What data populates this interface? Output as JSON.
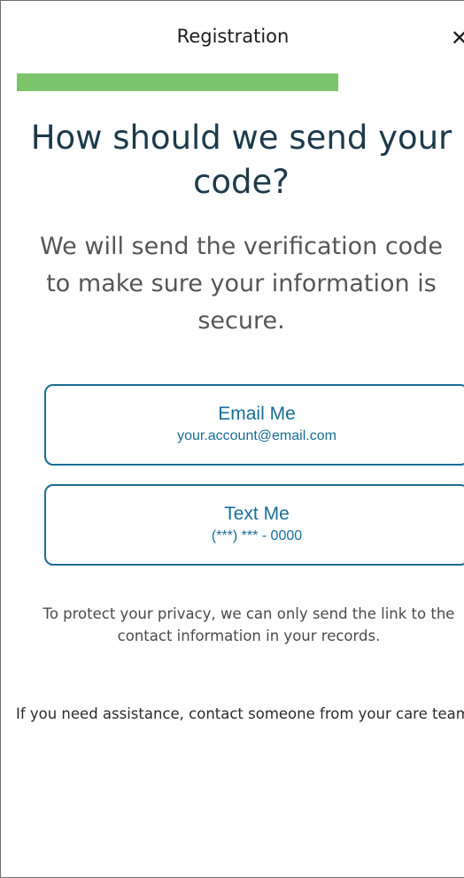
{
  "header": {
    "title": "Registration",
    "close_glyph": "✕"
  },
  "progress": {
    "fraction": 0.84,
    "color": "#7bc46b"
  },
  "main": {
    "headline": "How should we send your code?",
    "subtitle": "We will send the verification code to make sure your information is secure."
  },
  "options": {
    "email": {
      "title": "Email Me",
      "detail": "your.account@email.com"
    },
    "text": {
      "title": "Text Me",
      "detail": "(***) *** - 0000"
    }
  },
  "notes": {
    "privacy": "To protect your privacy, we can only send the link to the contact information in your records.",
    "assistance": "If you need assistance, contact someone from your care team."
  },
  "colors": {
    "accent": "#176e97",
    "headline": "#1d3a4a",
    "progress": "#7bc46b"
  }
}
